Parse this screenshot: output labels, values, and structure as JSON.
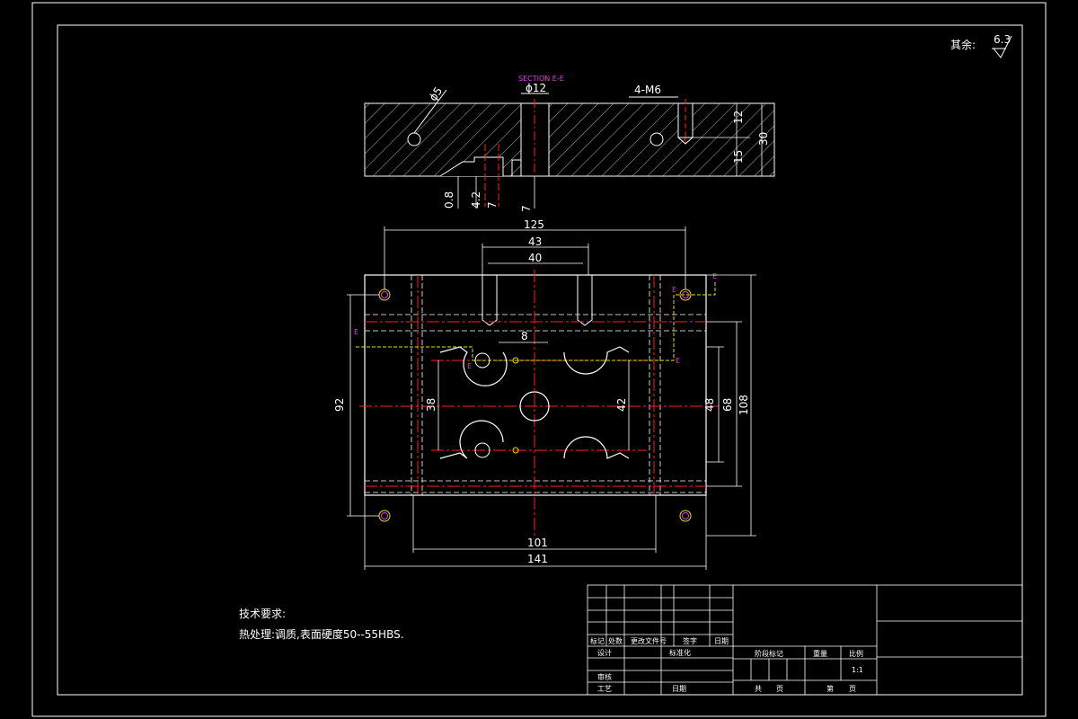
{
  "roughness": {
    "label": "其余:",
    "value": "6.3"
  },
  "section_label": "SECTION E-E",
  "top_view_dims": {
    "phi5": "ϕ5",
    "phi12": "ϕ12",
    "m6": "4-M6",
    "d12": "12",
    "d15": "15",
    "d30": "30",
    "d08": "0.8",
    "d42": "4.2",
    "d7a": "7",
    "d7b": "7"
  },
  "plan_view_dims": {
    "d125": "125",
    "d43": "43",
    "d40": "40",
    "d8": "8",
    "d92": "92",
    "d38": "38",
    "d42": "42",
    "d48": "48",
    "d68": "68",
    "d108": "108",
    "d101": "101",
    "d141": "141"
  },
  "section_marks": {
    "e1": "E",
    "e2": "E",
    "e3": "E",
    "e4": "E",
    "e5": "E"
  },
  "notes": {
    "title": "技术要求:",
    "line1": "热处理:调质,表面硬度50--55HBS."
  },
  "title_block": {
    "mark": "标记",
    "count": "处数",
    "doc": "更改文件号",
    "sign": "签字",
    "date": "日期",
    "design": "设计",
    "standard": "标准化",
    "review": "审核",
    "process": "工艺",
    "date2": "日期",
    "stage": "阶段标记",
    "weight": "重量",
    "scale": "比例",
    "scale_val": "1:1",
    "total": "共",
    "page": "页",
    "sheet": "第",
    "page2": "页"
  }
}
